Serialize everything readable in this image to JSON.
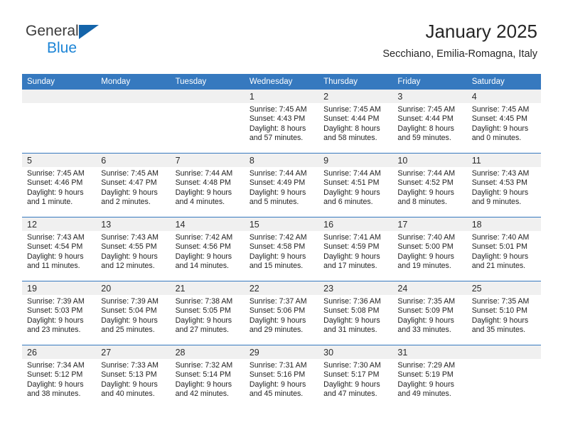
{
  "brand": {
    "name_top": "General",
    "name_bottom": "Blue",
    "accent_color": "#1b84d6",
    "triangle_color": "#1464aa"
  },
  "header": {
    "title": "January 2025",
    "subtitle": "Secchiano, Emilia-Romagna, Italy"
  },
  "theme": {
    "header_bg": "#3679bf",
    "header_text": "#ffffff",
    "date_bar_bg": "#f0f0f0",
    "cell_bg": "#ffffff"
  },
  "weekday_headers": [
    "Sunday",
    "Monday",
    "Tuesday",
    "Wednesday",
    "Thursday",
    "Friday",
    "Saturday"
  ],
  "labels": {
    "sunrise_prefix": "Sunrise:",
    "sunset_prefix": "Sunset:",
    "daylight_prefix": "Daylight:"
  },
  "weeks": [
    [
      {
        "date": "",
        "sunrise": "",
        "sunset": "",
        "daylight": "",
        "empty": true
      },
      {
        "date": "",
        "sunrise": "",
        "sunset": "",
        "daylight": "",
        "empty": true
      },
      {
        "date": "",
        "sunrise": "",
        "sunset": "",
        "daylight": "",
        "empty": true
      },
      {
        "date": "1",
        "sunrise": "Sunrise: 7:45 AM",
        "sunset": "Sunset: 4:43 PM",
        "daylight": "Daylight: 8 hours and 57 minutes.",
        "empty": false
      },
      {
        "date": "2",
        "sunrise": "Sunrise: 7:45 AM",
        "sunset": "Sunset: 4:44 PM",
        "daylight": "Daylight: 8 hours and 58 minutes.",
        "empty": false
      },
      {
        "date": "3",
        "sunrise": "Sunrise: 7:45 AM",
        "sunset": "Sunset: 4:44 PM",
        "daylight": "Daylight: 8 hours and 59 minutes.",
        "empty": false
      },
      {
        "date": "4",
        "sunrise": "Sunrise: 7:45 AM",
        "sunset": "Sunset: 4:45 PM",
        "daylight": "Daylight: 9 hours and 0 minutes.",
        "empty": false
      }
    ],
    [
      {
        "date": "5",
        "sunrise": "Sunrise: 7:45 AM",
        "sunset": "Sunset: 4:46 PM",
        "daylight": "Daylight: 9 hours and 1 minute.",
        "empty": false
      },
      {
        "date": "6",
        "sunrise": "Sunrise: 7:45 AM",
        "sunset": "Sunset: 4:47 PM",
        "daylight": "Daylight: 9 hours and 2 minutes.",
        "empty": false
      },
      {
        "date": "7",
        "sunrise": "Sunrise: 7:44 AM",
        "sunset": "Sunset: 4:48 PM",
        "daylight": "Daylight: 9 hours and 4 minutes.",
        "empty": false
      },
      {
        "date": "8",
        "sunrise": "Sunrise: 7:44 AM",
        "sunset": "Sunset: 4:49 PM",
        "daylight": "Daylight: 9 hours and 5 minutes.",
        "empty": false
      },
      {
        "date": "9",
        "sunrise": "Sunrise: 7:44 AM",
        "sunset": "Sunset: 4:51 PM",
        "daylight": "Daylight: 9 hours and 6 minutes.",
        "empty": false
      },
      {
        "date": "10",
        "sunrise": "Sunrise: 7:44 AM",
        "sunset": "Sunset: 4:52 PM",
        "daylight": "Daylight: 9 hours and 8 minutes.",
        "empty": false
      },
      {
        "date": "11",
        "sunrise": "Sunrise: 7:43 AM",
        "sunset": "Sunset: 4:53 PM",
        "daylight": "Daylight: 9 hours and 9 minutes.",
        "empty": false
      }
    ],
    [
      {
        "date": "12",
        "sunrise": "Sunrise: 7:43 AM",
        "sunset": "Sunset: 4:54 PM",
        "daylight": "Daylight: 9 hours and 11 minutes.",
        "empty": false
      },
      {
        "date": "13",
        "sunrise": "Sunrise: 7:43 AM",
        "sunset": "Sunset: 4:55 PM",
        "daylight": "Daylight: 9 hours and 12 minutes.",
        "empty": false
      },
      {
        "date": "14",
        "sunrise": "Sunrise: 7:42 AM",
        "sunset": "Sunset: 4:56 PM",
        "daylight": "Daylight: 9 hours and 14 minutes.",
        "empty": false
      },
      {
        "date": "15",
        "sunrise": "Sunrise: 7:42 AM",
        "sunset": "Sunset: 4:58 PM",
        "daylight": "Daylight: 9 hours and 15 minutes.",
        "empty": false
      },
      {
        "date": "16",
        "sunrise": "Sunrise: 7:41 AM",
        "sunset": "Sunset: 4:59 PM",
        "daylight": "Daylight: 9 hours and 17 minutes.",
        "empty": false
      },
      {
        "date": "17",
        "sunrise": "Sunrise: 7:40 AM",
        "sunset": "Sunset: 5:00 PM",
        "daylight": "Daylight: 9 hours and 19 minutes.",
        "empty": false
      },
      {
        "date": "18",
        "sunrise": "Sunrise: 7:40 AM",
        "sunset": "Sunset: 5:01 PM",
        "daylight": "Daylight: 9 hours and 21 minutes.",
        "empty": false
      }
    ],
    [
      {
        "date": "19",
        "sunrise": "Sunrise: 7:39 AM",
        "sunset": "Sunset: 5:03 PM",
        "daylight": "Daylight: 9 hours and 23 minutes.",
        "empty": false
      },
      {
        "date": "20",
        "sunrise": "Sunrise: 7:39 AM",
        "sunset": "Sunset: 5:04 PM",
        "daylight": "Daylight: 9 hours and 25 minutes.",
        "empty": false
      },
      {
        "date": "21",
        "sunrise": "Sunrise: 7:38 AM",
        "sunset": "Sunset: 5:05 PM",
        "daylight": "Daylight: 9 hours and 27 minutes.",
        "empty": false
      },
      {
        "date": "22",
        "sunrise": "Sunrise: 7:37 AM",
        "sunset": "Sunset: 5:06 PM",
        "daylight": "Daylight: 9 hours and 29 minutes.",
        "empty": false
      },
      {
        "date": "23",
        "sunrise": "Sunrise: 7:36 AM",
        "sunset": "Sunset: 5:08 PM",
        "daylight": "Daylight: 9 hours and 31 minutes.",
        "empty": false
      },
      {
        "date": "24",
        "sunrise": "Sunrise: 7:35 AM",
        "sunset": "Sunset: 5:09 PM",
        "daylight": "Daylight: 9 hours and 33 minutes.",
        "empty": false
      },
      {
        "date": "25",
        "sunrise": "Sunrise: 7:35 AM",
        "sunset": "Sunset: 5:10 PM",
        "daylight": "Daylight: 9 hours and 35 minutes.",
        "empty": false
      }
    ],
    [
      {
        "date": "26",
        "sunrise": "Sunrise: 7:34 AM",
        "sunset": "Sunset: 5:12 PM",
        "daylight": "Daylight: 9 hours and 38 minutes.",
        "empty": false
      },
      {
        "date": "27",
        "sunrise": "Sunrise: 7:33 AM",
        "sunset": "Sunset: 5:13 PM",
        "daylight": "Daylight: 9 hours and 40 minutes.",
        "empty": false
      },
      {
        "date": "28",
        "sunrise": "Sunrise: 7:32 AM",
        "sunset": "Sunset: 5:14 PM",
        "daylight": "Daylight: 9 hours and 42 minutes.",
        "empty": false
      },
      {
        "date": "29",
        "sunrise": "Sunrise: 7:31 AM",
        "sunset": "Sunset: 5:16 PM",
        "daylight": "Daylight: 9 hours and 45 minutes.",
        "empty": false
      },
      {
        "date": "30",
        "sunrise": "Sunrise: 7:30 AM",
        "sunset": "Sunset: 5:17 PM",
        "daylight": "Daylight: 9 hours and 47 minutes.",
        "empty": false
      },
      {
        "date": "31",
        "sunrise": "Sunrise: 7:29 AM",
        "sunset": "Sunset: 5:19 PM",
        "daylight": "Daylight: 9 hours and 49 minutes.",
        "empty": false
      },
      {
        "date": "",
        "sunrise": "",
        "sunset": "",
        "daylight": "",
        "empty": true
      }
    ]
  ]
}
